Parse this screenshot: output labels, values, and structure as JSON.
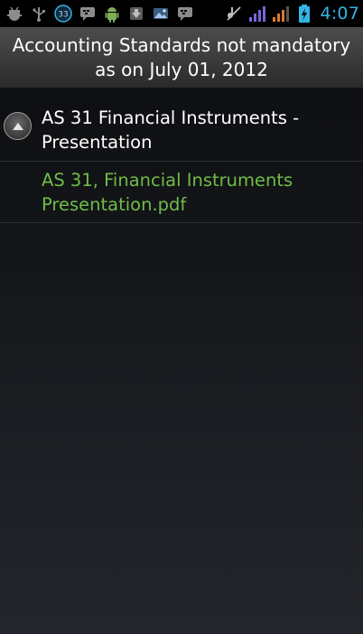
{
  "status_bar": {
    "left_icons": [
      "usb-debugging-icon",
      "usb-icon",
      "notification-badge-icon",
      "bbm-chat-icon",
      "android-icon",
      "download-icon",
      "image-icon",
      "bbm-chat-icon"
    ],
    "right_icons": [
      "no-sound-icon",
      "signal-strength-icon",
      "signal-strength-icon",
      "battery-charging-icon"
    ],
    "badge_number": "33",
    "time": "4:07",
    "accent_color": "#33b5e5"
  },
  "title_bar": {
    "title": "Accounting Standards not mandatory\nas on July 01, 2012"
  },
  "list": {
    "group": {
      "label": "AS 31 Financial Instruments -\nPresentation",
      "indicator_icon": "collapse-arrow-icon",
      "expanded": true
    },
    "child": {
      "label": "AS 31, Financial Instruments\nPresentation.pdf",
      "color": "#6fbd48"
    }
  }
}
